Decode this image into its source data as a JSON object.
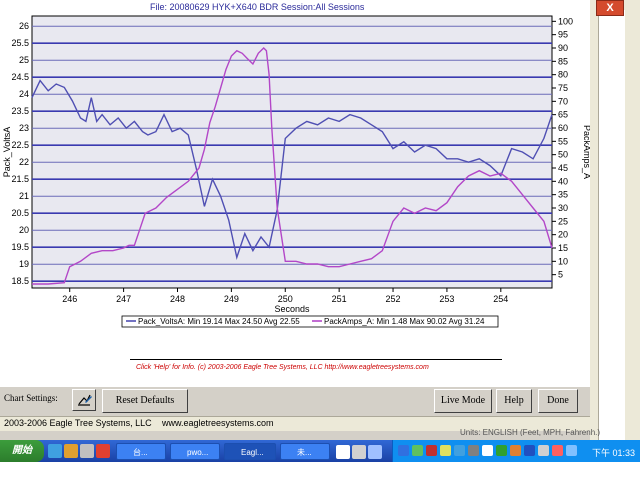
{
  "window": {
    "file_title": "File: 20080629 HYK+X640 BDR   Session:All Sessions",
    "close_glyph": "X"
  },
  "chart_data": {
    "type": "line",
    "xlabel": "Seconds",
    "ylabel_left": "Pack_VoltsA",
    "ylabel_right": "PackAmps_A",
    "x_ticks": [
      246,
      247,
      248,
      249,
      250,
      251,
      252,
      253,
      254
    ],
    "xlim": [
      245.3,
      254.95
    ],
    "ylim_left": [
      18.3,
      26.3
    ],
    "y_ticks_left": [
      18.5,
      19,
      19.5,
      20,
      20.5,
      21,
      21.5,
      22,
      22.5,
      23,
      23.5,
      24,
      24.5,
      25,
      25.5,
      26
    ],
    "ylim_right": [
      0,
      102
    ],
    "y_ticks_right": [
      5,
      10,
      15,
      20,
      25,
      30,
      35,
      40,
      45,
      50,
      55,
      60,
      65,
      70,
      75,
      80,
      85,
      90,
      95,
      100
    ],
    "grid": true,
    "series": [
      {
        "name": "Pack_VoltsA",
        "axis": "left",
        "color": "#4f4fb3",
        "summary": "Min 19.14 Max 24.50 Avg 22.55",
        "x": [
          245.3,
          245.45,
          245.6,
          245.75,
          245.9,
          246.05,
          246.2,
          246.3,
          246.4,
          246.5,
          246.6,
          246.75,
          246.9,
          247.05,
          247.2,
          247.35,
          247.45,
          247.6,
          247.75,
          247.9,
          248.05,
          248.2,
          248.35,
          248.5,
          248.65,
          248.8,
          248.95,
          249.1,
          249.25,
          249.4,
          249.55,
          249.7,
          249.85,
          250.0,
          250.2,
          250.4,
          250.6,
          250.8,
          251.0,
          251.2,
          251.4,
          251.6,
          251.8,
          252.0,
          252.2,
          252.4,
          252.6,
          252.8,
          253.0,
          253.2,
          253.4,
          253.6,
          253.8,
          254.0,
          254.2,
          254.4,
          254.6,
          254.8,
          254.95
        ],
        "y": [
          23.9,
          24.4,
          24.1,
          24.3,
          24.2,
          23.8,
          23.3,
          23.2,
          23.9,
          23.2,
          23.4,
          23.1,
          23.3,
          23.0,
          23.2,
          22.9,
          22.8,
          22.9,
          23.4,
          22.9,
          23.0,
          22.8,
          21.8,
          20.7,
          21.5,
          21.0,
          20.3,
          19.2,
          19.9,
          19.4,
          19.8,
          19.5,
          20.6,
          22.7,
          23.0,
          23.2,
          23.1,
          23.3,
          23.2,
          23.4,
          23.3,
          23.1,
          22.9,
          22.4,
          22.6,
          22.3,
          22.5,
          22.4,
          22.1,
          22.1,
          22.0,
          22.1,
          21.9,
          21.6,
          22.4,
          22.3,
          22.1,
          22.7,
          23.4
        ]
      },
      {
        "name": "PackAmps_A",
        "axis": "right",
        "color": "#b347c8",
        "summary": "Min 1.48 Max 90.02 Avg 31.24",
        "x": [
          245.3,
          245.6,
          245.9,
          246.0,
          246.2,
          246.4,
          246.6,
          246.8,
          247.0,
          247.1,
          247.2,
          247.4,
          247.6,
          247.8,
          248.0,
          248.2,
          248.4,
          248.5,
          248.6,
          248.7,
          248.8,
          248.9,
          249.0,
          249.1,
          249.2,
          249.3,
          249.4,
          249.5,
          249.6,
          249.65,
          249.7,
          249.75,
          249.85,
          250.0,
          250.2,
          250.4,
          250.6,
          250.8,
          251.0,
          251.2,
          251.4,
          251.6,
          251.8,
          252.0,
          252.2,
          252.4,
          252.6,
          252.8,
          253.0,
          253.2,
          253.4,
          253.6,
          253.8,
          254.0,
          254.2,
          254.4,
          254.6,
          254.8,
          254.95
        ],
        "y": [
          1.5,
          1.5,
          2.0,
          8,
          10,
          13,
          14,
          14,
          15,
          16,
          16,
          28,
          30,
          34,
          37,
          40,
          45,
          52,
          62,
          68,
          75,
          82,
          87,
          89,
          88,
          86,
          84,
          88,
          90,
          89,
          80,
          60,
          30,
          10,
          10,
          9,
          9,
          8,
          8,
          9,
          10,
          11,
          14,
          25,
          30,
          28,
          30,
          29,
          32,
          38,
          42,
          44,
          42,
          43,
          40,
          35,
          30,
          25,
          15
        ]
      }
    ]
  },
  "info_line": "Click 'Help' for Info. (c) 2003-2006 Eagle Tree Systems, LLC       http://www.eagletreesystems.com",
  "toolbar": {
    "chart_settings_label": "Chart Settings:",
    "reset_label": "Reset Defaults",
    "live_label": "Live Mode",
    "help_label": "Help",
    "done_label": "Done"
  },
  "status": {
    "copyright": "2003-2006 Eagle Tree Systems, LLC",
    "url": "www.eagletreesystems.com",
    "units": "Units: ENGLISH (Feet, MPH, Fahrenh.)"
  },
  "taskbar": {
    "start_label": "開始",
    "tasks": [
      "台...",
      "pwo...",
      "Eagl...",
      "未..."
    ],
    "clock": "下午 01:33"
  }
}
